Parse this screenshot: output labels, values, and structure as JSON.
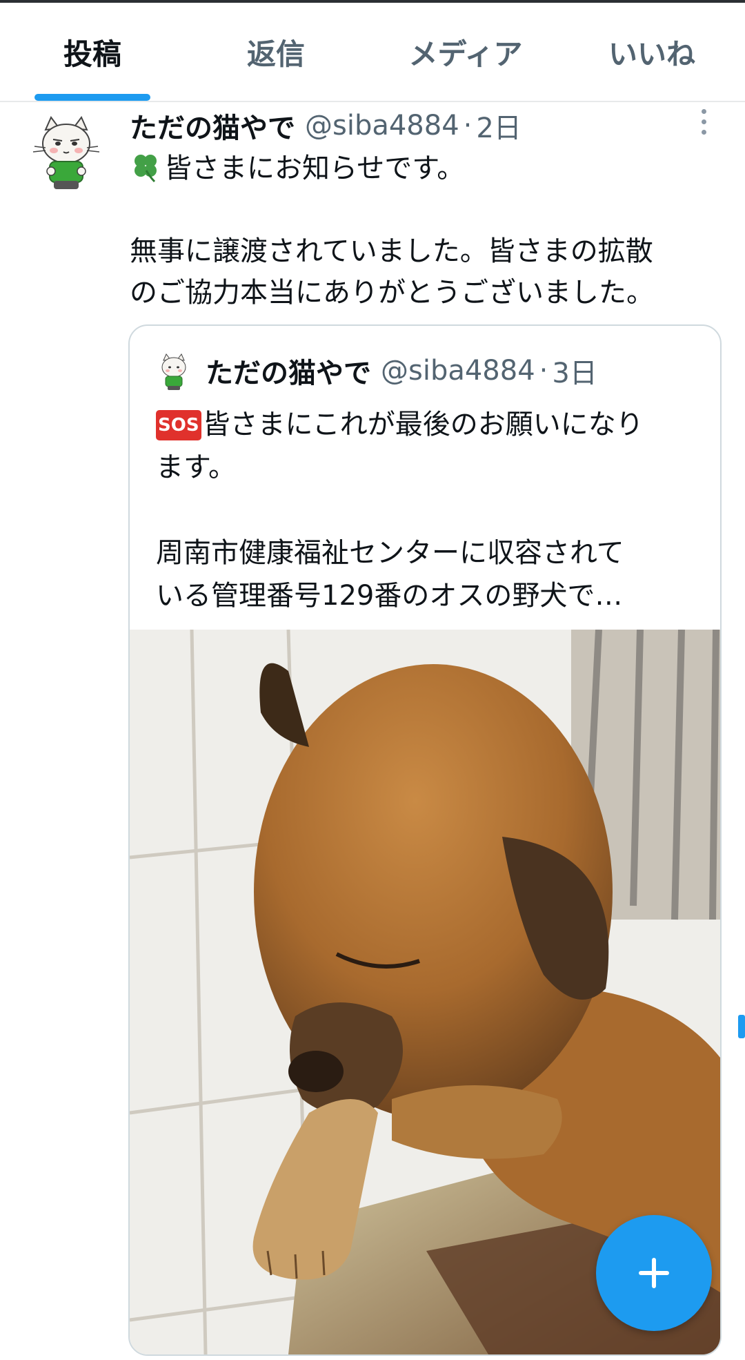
{
  "tabs": [
    {
      "label": "投稿",
      "active": true
    },
    {
      "label": "返信",
      "active": false
    },
    {
      "label": "メディア",
      "active": false
    },
    {
      "label": "いいね",
      "active": false
    }
  ],
  "tweet": {
    "author_name": "ただの猫やで",
    "handle": "@siba4884",
    "time": "2日",
    "line1": "皆さまにお知らせです。",
    "line2": "無事に譲渡されていました。皆さまの拡散",
    "line3": "のご協力本当にありがとうございました。",
    "icons": {
      "avatar": "cat-avatar",
      "menu": "more-vertical-icon",
      "emoji": "four-leaf-clover"
    }
  },
  "quote": {
    "author_name": "ただの猫やで",
    "handle": "@siba4884",
    "time": "3日",
    "sos_label": "SOS",
    "line1": "皆さまにこれが最後のお願いになり",
    "line2": "ます。",
    "line3": "周南市健康福祉センターに収容されて",
    "line4": "いる管理番号129番のオスの野犬で…",
    "photo": "dog-photo"
  },
  "fab": {
    "icon": "plus-icon"
  },
  "colors": {
    "accent": "#1d9bf0",
    "secondary_text": "#536471",
    "border": "#cfd9de",
    "sos": "#e0312c"
  }
}
